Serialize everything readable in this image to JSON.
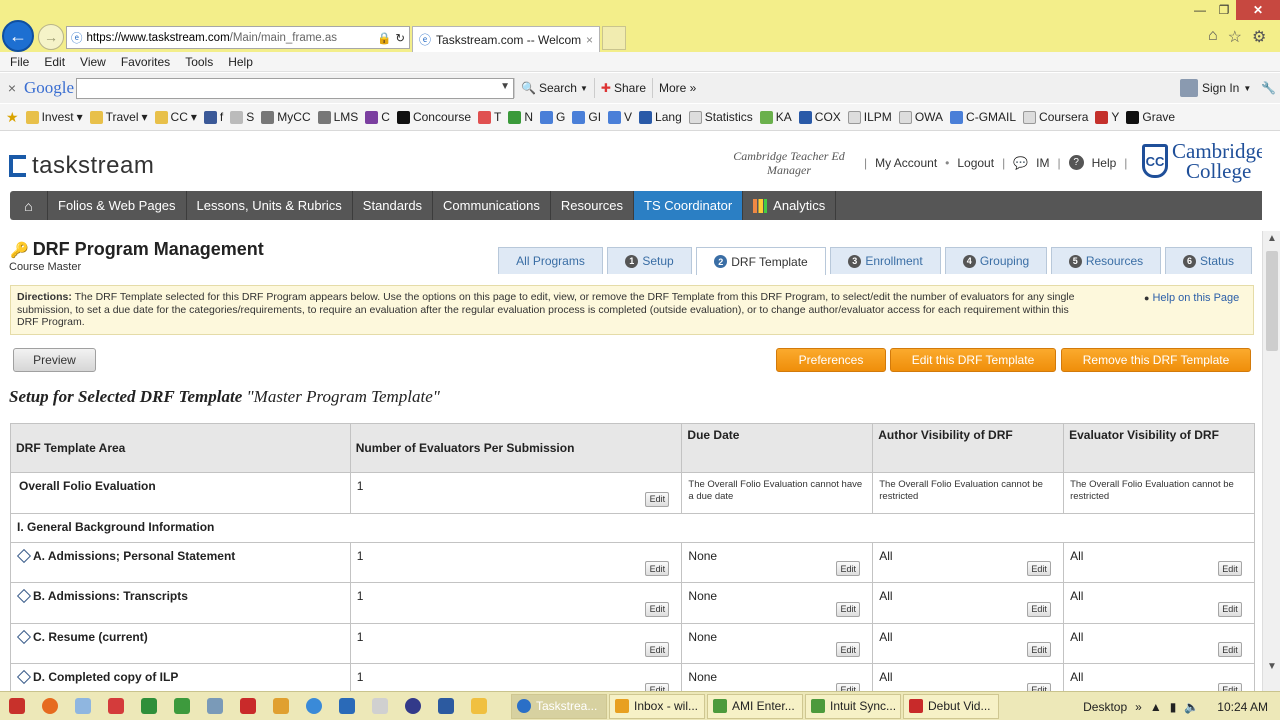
{
  "browser": {
    "url_base": "https://www.taskstream.com",
    "url_path": "/Main/main_frame.as",
    "tab_title": "Taskstream.com -- Welcome",
    "menu": [
      "File",
      "Edit",
      "View",
      "Favorites",
      "Tools",
      "Help"
    ],
    "google": {
      "logo": "Google",
      "search_label": "Search",
      "share_label": "Share",
      "more_label": "More »",
      "signin_label": "Sign In"
    },
    "favorites": [
      "Invest",
      "Travel",
      "CC",
      "f",
      "S",
      "MyCC",
      "LMS",
      "C",
      "Concourse",
      "T",
      "N",
      "G",
      "GI",
      "V",
      "Lang",
      "Statistics",
      "KA",
      "COX",
      "ILPM",
      "OWA",
      "C-GMAIL",
      "Coursera",
      "Y",
      "Grave"
    ]
  },
  "header": {
    "logo_text": "taskstream",
    "user_role": "Cambridge Teacher Ed Manager",
    "links": {
      "my_account": "My Account",
      "logout": "Logout",
      "im": "IM",
      "help": "Help"
    },
    "college_name_1": "Cambridge",
    "college_name_2": "College"
  },
  "nav": [
    "Folios & Web Pages",
    "Lessons, Units & Rubrics",
    "Standards",
    "Communications",
    "Resources",
    "TS Coordinator",
    "Analytics"
  ],
  "page": {
    "title": "DRF Program Management",
    "subtitle": "Course Master",
    "tabs": [
      {
        "num": "",
        "label": "All Programs"
      },
      {
        "num": "1",
        "label": "Setup"
      },
      {
        "num": "2",
        "label": "DRF Template"
      },
      {
        "num": "3",
        "label": "Enrollment"
      },
      {
        "num": "4",
        "label": "Grouping"
      },
      {
        "num": "5",
        "label": "Resources"
      },
      {
        "num": "6",
        "label": "Status"
      }
    ],
    "directions_label": "Directions:",
    "directions_text": "The DRF Template selected for this DRF Program appears below. Use the options on this page to edit, view, or remove the DRF Template from this DRF Program, to select/edit the number of evaluators for any single submission, to set a due date for the categories/requirements, to require an evaluation after the regular evaluation process is completed (outside evaluation), or to change author/evaluator access for each requirement within this DRF Program.",
    "help_link": "Help on this Page",
    "buttons": {
      "preview": "Preview",
      "preferences": "Preferences",
      "edit_template": "Edit this DRF Template",
      "remove_template": "Remove this DRF Template"
    },
    "setup_heading": "Setup for Selected DRF Template",
    "template_name": "\"Master Program Template\""
  },
  "table": {
    "headers": [
      "DRF Template Area",
      "Number of Evaluators Per Submission",
      "Due Date",
      "Author Visibility of DRF",
      "Evaluator Visibility of DRF"
    ],
    "edit_label": "Edit",
    "overall": {
      "name": "Overall Folio Evaluation",
      "evaluators": "1",
      "due": "The Overall Folio Evaluation cannot have a due date",
      "author": "The Overall Folio Evaluation cannot be restricted",
      "evaluator": "The Overall Folio Evaluation cannot be restricted"
    },
    "section": "I. General Background Information",
    "rows": [
      {
        "name": "A. Admissions; Personal Statement",
        "evaluators": "1",
        "due": "None",
        "author": "All",
        "evaluator": "All"
      },
      {
        "name": "B. Admissions: Transcripts",
        "evaluators": "1",
        "due": "None",
        "author": "All",
        "evaluator": "All"
      },
      {
        "name": "C. Resume (current)",
        "evaluators": "1",
        "due": "None",
        "author": "All",
        "evaluator": "All"
      },
      {
        "name": "D. Completed copy of ILP",
        "evaluators": "1",
        "due": "None",
        "author": "All",
        "evaluator": "All"
      }
    ]
  },
  "taskbar": {
    "tasks": [
      "Taskstrea...",
      "Inbox - wil...",
      "AMI Enter...",
      "Intuit Sync...",
      "Debut Vid..."
    ],
    "desktop": "Desktop",
    "time": "10:24 AM"
  }
}
